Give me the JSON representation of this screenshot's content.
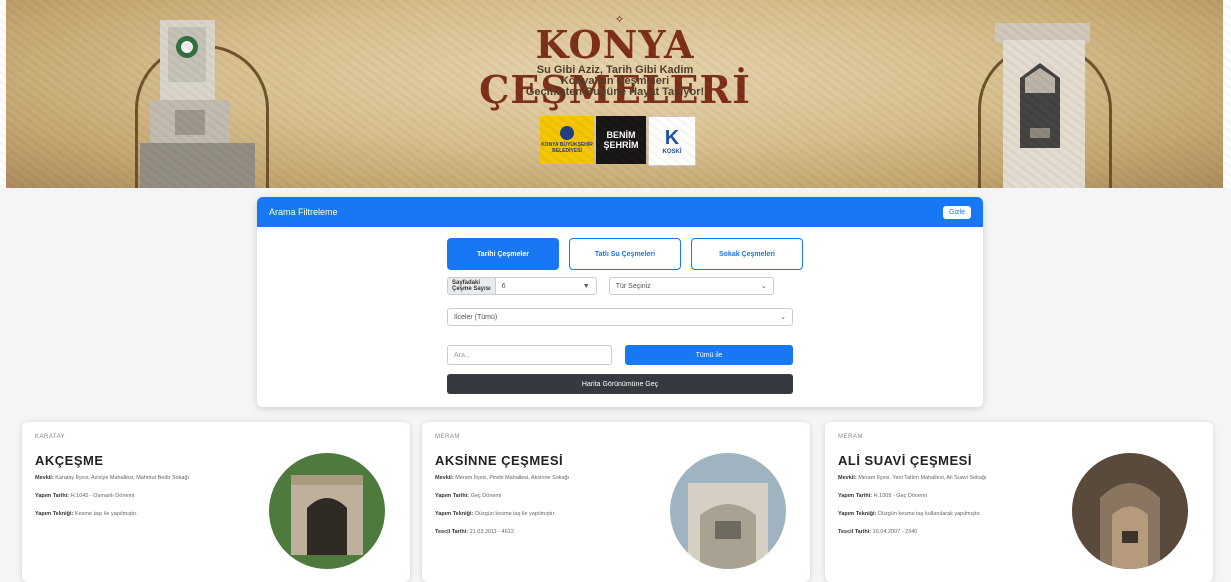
{
  "banner": {
    "ornament": "⟡",
    "title": "KONYA ÇEŞMELERİ",
    "subtitle_lines": [
      "Su Gibi Aziz, Tarih Gibi Kadim",
      "Konya'nın Çeşmeleri",
      "Geçmişten Bugüne Hayat Taşıyor!"
    ],
    "logos": {
      "kb": "KONYA BÜYÜKŞEHİR BELEDİYESİ",
      "bs_line1": "BENİM",
      "bs_line2": "ŞEHRİM",
      "kk": "KOSKİ"
    }
  },
  "filter": {
    "title": "Arama Filtreleme",
    "hide_label": "Gizle",
    "tabs": [
      "Tarihi Çeşmeler",
      "Tatlı Su Çeşmeleri",
      "Sokak Çeşmeleri"
    ],
    "per_page_label_1": "Sayfadaki",
    "per_page_label_2": "Çeşme Sayısı",
    "per_page_value": "6",
    "type_placeholder": "Tür Seçiniz",
    "district_value": "Ilceler (Tümü)",
    "search_placeholder": "Ara...",
    "search_button": "Tümü ile",
    "map_button": "Harita Görünümüne Geç"
  },
  "cards": [
    {
      "district": "KARATAY",
      "name": "AKÇEŞME",
      "location_label": "Mevkii:",
      "location": "Karatay İlçesi, Aziziye Mahallesi, Mahmut Bedir Sokağı",
      "date_label": "Yapım Tarihi:",
      "date": "H.1045 - Osmanlı Dönemi",
      "tech_label": "Yapım Tekniği:",
      "tech": "Kesme taşı ile yapılmıştır.",
      "reg_label": "",
      "reg": ""
    },
    {
      "district": "MERAM",
      "name": "AKSİNNE ÇEŞMESİ",
      "location_label": "Mevkii:",
      "location": "Meram İlçesi, Pirebi Mahallesi, Aksinne Sokağı",
      "date_label": "Yapım Tarihi:",
      "date": "Geç Dönemi",
      "tech_label": "Yapım Tekniği:",
      "tech": "Düzgün kesme taş ile yapılmıştır.",
      "reg_label": "Tescil Tarihi:",
      "reg": "21.03.2011 - 4612"
    },
    {
      "district": "MERAM",
      "name": "ALİ SUAVİ ÇEŞMESİ",
      "location_label": "Mevkii:",
      "location": "Meram İlçesi, Yeni Tatlım Mahallesi, Ali Suavi Sokağı",
      "date_label": "Yapım Tarihi:",
      "date": "H.1009 - Geç Dönemi",
      "tech_label": "Yapım Tekniği:",
      "tech": "Düzgün kesme taş kullanılarak yapılmıştır.",
      "reg_label": "Tescil Tarihi:",
      "reg": "16.04.2007 - 2340"
    }
  ],
  "colors": {
    "primary": "#1877f2",
    "dark": "#343a40",
    "title": "#7a2a15"
  }
}
